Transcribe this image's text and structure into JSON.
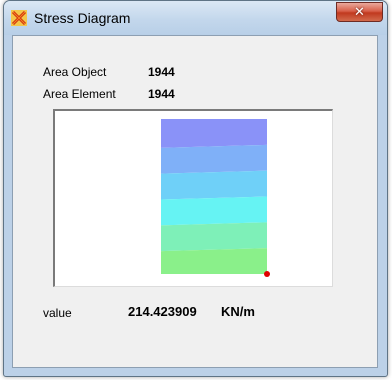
{
  "window": {
    "title": "Stress Diagram",
    "close_glyph": "✕"
  },
  "area_object": {
    "label": "Area Object",
    "value": "1944"
  },
  "area_element": {
    "label": "Area Element",
    "value": "1944"
  },
  "result": {
    "label": "value",
    "value": "214.423909",
    "unit": "KN/m"
  },
  "contour": {
    "band_colors": [
      "#8a92f8",
      "#7fb0f8",
      "#6fd0f8",
      "#66f3f3",
      "#7ef0b8",
      "#8af08a"
    ],
    "marker_color": "#e00000"
  },
  "icons": {
    "app": "sap2000-x-icon",
    "close": "close-icon"
  }
}
